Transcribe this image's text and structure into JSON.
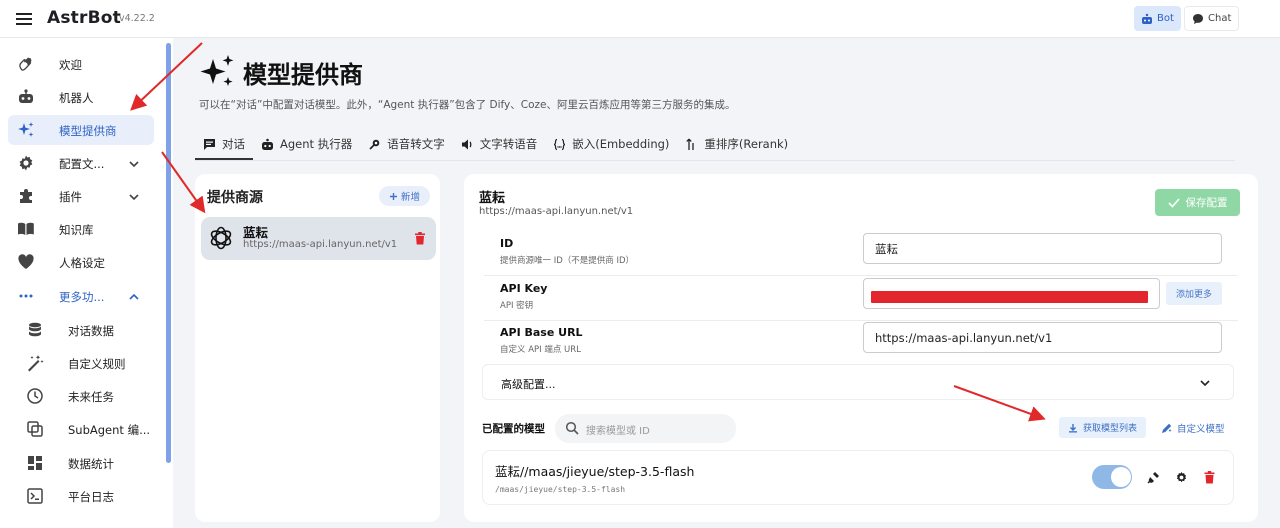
{
  "app": {
    "title": "AstrBot",
    "version": "v4.22.2"
  },
  "topbar": {
    "bot_label": "Bot",
    "chat_label": "Chat"
  },
  "sidebar": {
    "items": [
      {
        "label": "欢迎",
        "icon": "hand-wave-icon"
      },
      {
        "label": "机器人",
        "icon": "robot-icon"
      },
      {
        "label": "模型提供商",
        "icon": "sparkles-icon"
      },
      {
        "label": "配置文...",
        "icon": "gear-icon"
      },
      {
        "label": "插件",
        "icon": "puzzle-icon"
      },
      {
        "label": "知识库",
        "icon": "book-icon"
      },
      {
        "label": "人格设定",
        "icon": "heart-icon"
      },
      {
        "label": "更多功...",
        "icon": "more-dots-icon"
      }
    ],
    "sub_items": [
      {
        "label": "对话数据",
        "icon": "database-icon"
      },
      {
        "label": "自定义规则",
        "icon": "magic-wand-icon"
      },
      {
        "label": "未来任务",
        "icon": "clock-icon"
      },
      {
        "label": "SubAgent 编...",
        "icon": "subagent-icon"
      },
      {
        "label": "数据统计",
        "icon": "dashboard-icon"
      },
      {
        "label": "平台日志",
        "icon": "console-icon"
      }
    ]
  },
  "page": {
    "title": "模型提供商",
    "description": "可以在“对话”中配置对话模型。此外，“Agent 执行器”包含了 Dify、Coze、阿里云百炼应用等第三方服务的集成。"
  },
  "tabs": [
    {
      "label": "对话",
      "icon": "chat-icon"
    },
    {
      "label": "Agent 执行器",
      "icon": "robot-icon"
    },
    {
      "label": "语音转文字",
      "icon": "voice-icon"
    },
    {
      "label": "文字转语音",
      "icon": "speaker-icon"
    },
    {
      "label": "嵌入(Embedding)",
      "icon": "braces-icon"
    },
    {
      "label": "重排序(Rerank)",
      "icon": "sort-icon"
    }
  ],
  "providers": {
    "title": "提供商源",
    "add_label": "新增",
    "items": [
      {
        "name": "蓝耘",
        "url": "https://maas-api.lanyun.net/v1"
      }
    ]
  },
  "detail": {
    "name": "蓝耘",
    "url": "https://maas-api.lanyun.net/v1",
    "save_label": "保存配置",
    "fields": {
      "id": {
        "label": "ID",
        "hint": "提供商源唯一 ID（不是提供商 ID）",
        "value": "蓝耘"
      },
      "api_key": {
        "label": "API Key",
        "hint": "API 密钥",
        "add_more": "添加更多"
      },
      "api_base": {
        "label": "API Base URL",
        "hint": "自定义 API 端点 URL",
        "value": "https://maas-api.lanyun.net/v1"
      }
    },
    "advanced_label": "高级配置...",
    "models": {
      "title": "已配置的模型",
      "search_placeholder": "搜索模型或 ID",
      "fetch_label": "获取模型列表",
      "custom_label": "自定义模型",
      "items": [
        {
          "name": "蓝耘//maas/jieyue/step-3.5-flash",
          "id": "/maas/jieyue/step-3.5-flash",
          "enabled": true
        }
      ]
    }
  },
  "colors": {
    "accent": "#2f63c4",
    "save": "#8fd8a6",
    "danger": "#e3262d",
    "arrow": "#e02a2a"
  }
}
